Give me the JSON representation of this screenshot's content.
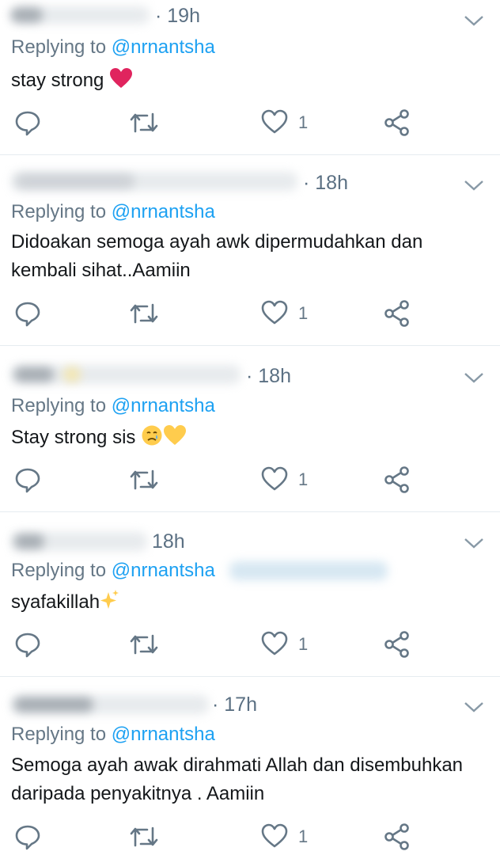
{
  "tweets": [
    {
      "time": "· 19h",
      "reply_prefix": "Replying to",
      "handle": "@nrnantsha",
      "text": "stay strong",
      "like_count": "1"
    },
    {
      "time": "· 18h",
      "reply_prefix": "Replying to",
      "handle": "@nrnantsha",
      "text": "Didoakan semoga ayah awk dipermudahkan dan kembali sihat..Aamiin",
      "like_count": "1"
    },
    {
      "time": "· 18h",
      "reply_prefix": "Replying to",
      "handle": "@nrnantsha",
      "text": "Stay strong sis",
      "like_count": "1"
    },
    {
      "time": "18h",
      "reply_prefix": "Replying to",
      "handle": "@nrnantsha",
      "text": "syafakillah",
      "like_count": "1"
    },
    {
      "time": "· 17h",
      "reply_prefix": "Replying to",
      "handle": "@nrnantsha",
      "text": "Semoga ayah awak dirahmati Allah dan disembuhkan daripada penyakitnya . Aamiin",
      "like_count": "1"
    }
  ],
  "colors": {
    "link": "#1da1f2",
    "secondary": "#657786",
    "icon": "#657786",
    "heart_emoji": "#e0245e",
    "yellow_heart": "#ffcc4d"
  },
  "icons": [
    "reply-icon",
    "retweet-icon",
    "like-icon",
    "share-icon",
    "chevron-down-icon"
  ]
}
